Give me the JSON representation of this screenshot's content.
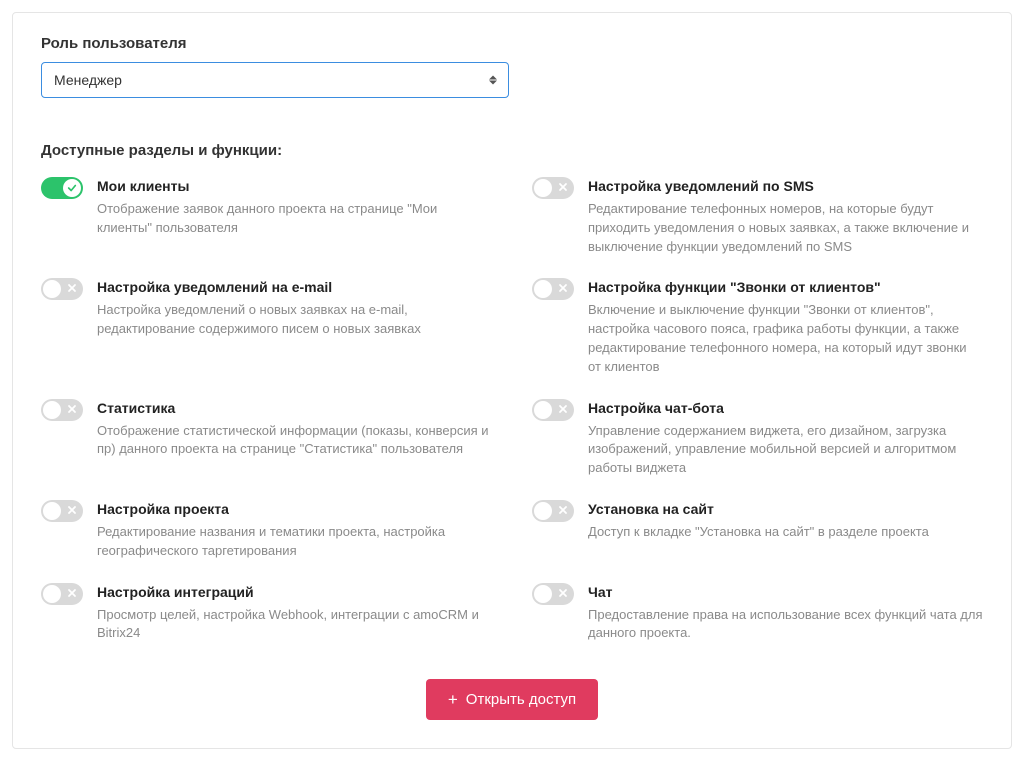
{
  "role": {
    "label": "Роль пользователя",
    "selected": "Менеджер"
  },
  "section_title": "Доступные разделы и функции:",
  "permissions": [
    {
      "key": "my-clients",
      "on": true,
      "title": "Мои клиенты",
      "desc": "Отображение заявок данного проекта на странице \"Мои клиенты\" пользователя"
    },
    {
      "key": "sms-notify",
      "on": false,
      "title": "Настройка уведомлений по SMS",
      "desc": "Редактирование телефонных номеров, на которые будут приходить уведомления о новых заявках, а также включение и выключение функции уведомлений по SMS"
    },
    {
      "key": "email-notify",
      "on": false,
      "title": "Настройка уведомлений на e-mail",
      "desc": "Настройка уведомлений о новых заявках на e-mail, редактирование содержимого писем о новых заявках"
    },
    {
      "key": "client-calls",
      "on": false,
      "title": "Настройка функции \"Звонки от клиентов\"",
      "desc": "Включение и выключение функции \"Звонки от клиентов\", настройка часового пояса, графика работы функции, а также редактирование телефонного номера, на который идут звонки от клиентов"
    },
    {
      "key": "statistics",
      "on": false,
      "title": "Статистика",
      "desc": "Отображение статистической информации (показы, конверсия и пр) данного проекта на странице \"Статистика\" пользователя"
    },
    {
      "key": "chatbot",
      "on": false,
      "title": "Настройка чат-бота",
      "desc": "Управление содержанием виджета, его дизайном, загрузка изображений, управление мобильной версией и алгоритмом работы виджета"
    },
    {
      "key": "project-settings",
      "on": false,
      "title": "Настройка проекта",
      "desc": "Редактирование названия и тематики проекта, настройка географического таргетирования"
    },
    {
      "key": "install",
      "on": false,
      "title": "Установка на сайт",
      "desc": "Доступ к вкладке \"Установка на сайт\" в разделе проекта"
    },
    {
      "key": "integrations",
      "on": false,
      "title": "Настройка интеграций",
      "desc": "Просмотр целей, настройка Webhook, интеграции с amoCRM и Bitrix24"
    },
    {
      "key": "chat",
      "on": false,
      "title": "Чат",
      "desc": "Предоставление права на использование всех функций чата для данного проекта."
    }
  ],
  "submit": {
    "label": "Открыть доступ",
    "plus": "+"
  }
}
